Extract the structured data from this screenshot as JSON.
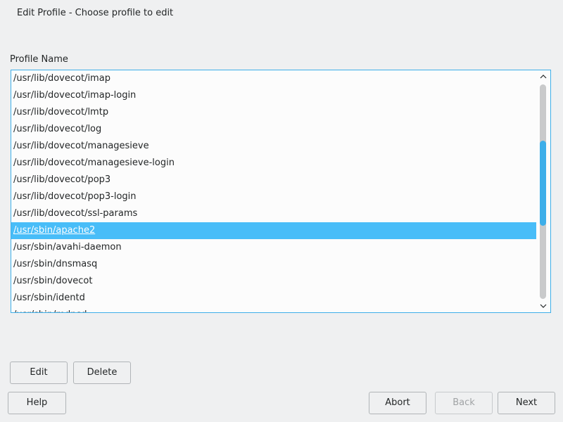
{
  "window": {
    "title": "Edit Profile - Choose profile to edit"
  },
  "list": {
    "label": "Profile Name",
    "items": [
      "/usr/lib/dovecot/imap",
      "/usr/lib/dovecot/imap-login",
      "/usr/lib/dovecot/lmtp",
      "/usr/lib/dovecot/log",
      "/usr/lib/dovecot/managesieve",
      "/usr/lib/dovecot/managesieve-login",
      "/usr/lib/dovecot/pop3",
      "/usr/lib/dovecot/pop3-login",
      "/usr/lib/dovecot/ssl-params",
      "/usr/sbin/apache2",
      "/usr/sbin/avahi-daemon",
      "/usr/sbin/dnsmasq",
      "/usr/sbin/dovecot",
      "/usr/sbin/identd",
      "/usr/sbin/mdnsd"
    ],
    "selected_index": 9
  },
  "buttons": {
    "edit": "Edit",
    "delete": "Delete",
    "help": "Help",
    "abort": "Abort",
    "back": "Back",
    "next": "Next"
  },
  "icons": {
    "scroll_up": "chevron-up-icon",
    "scroll_down": "chevron-down-icon"
  },
  "colors": {
    "accent": "#3daee9",
    "selection": "#48bdf8",
    "background": "#eff0f1"
  }
}
